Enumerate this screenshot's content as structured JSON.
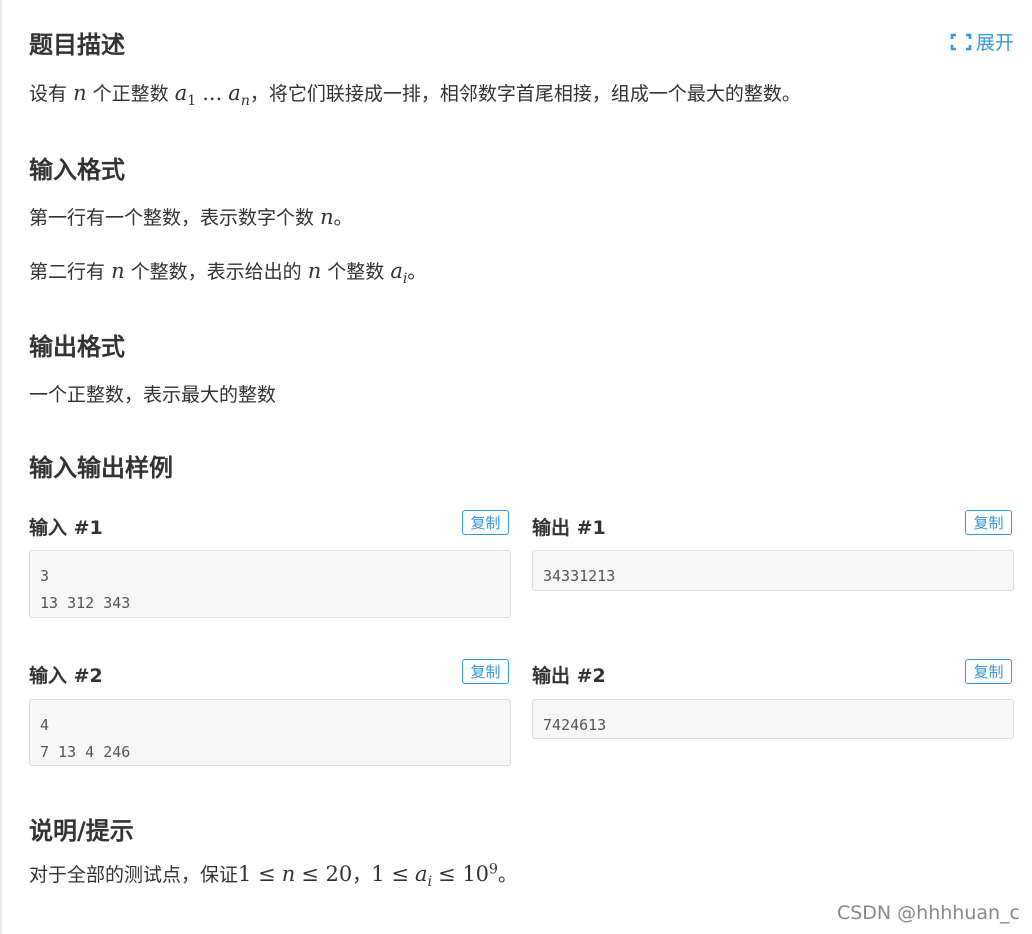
{
  "expand_label": "展开",
  "sections": {
    "description": {
      "title": "题目描述",
      "text_1": "设有",
      "n": "n",
      "text_2": "个正整数",
      "a": "a",
      "sub_1": "1",
      "dots": "...",
      "sub_n": "n",
      "text_3": "，将它们联接成一排，相邻数字首尾相接，组成一个最大的整数。"
    },
    "input_format": {
      "title": "输入格式",
      "line1_text": "第一行有一个整数，表示数字个数",
      "line1_var": "n",
      "line1_end": "。",
      "line2_text1": "第二行有",
      "line2_var1": "n",
      "line2_text2": "个整数，表示给出的",
      "line2_var2": "n",
      "line2_text3": "个整数",
      "line2_var3": "a",
      "line2_sub": "i",
      "line2_end": "。"
    },
    "output_format": {
      "title": "输出格式",
      "text": "一个正整数，表示最大的整数"
    },
    "samples_title": "输入输出样例",
    "hint": {
      "title": "说明/提示",
      "text": "对于全部的测试点，保证",
      "c1": "1 ≤",
      "v1": "n",
      "c2": "≤ 20",
      "sep": "，",
      "c3": "1 ≤",
      "v2": "a",
      "sub": "i",
      "c4": "≤ 10",
      "exp": "9",
      "end": "。"
    }
  },
  "samples": [
    {
      "input_label": "输入 #1",
      "input_copy": "复制",
      "input": "3\n13 312 343",
      "output_label": "输出 #1",
      "output_copy": "复制",
      "output": "34331213"
    },
    {
      "input_label": "输入 #2",
      "input_copy": "复制",
      "input": "4\n7 13 4 246",
      "output_label": "输出 #2",
      "output_copy": "复制",
      "output": "7424613"
    }
  ],
  "watermark": "CSDN @hhhhuan_c",
  "colors": {
    "accent": "#3498db",
    "text": "#333333",
    "code_bg": "#f7f7f7"
  }
}
